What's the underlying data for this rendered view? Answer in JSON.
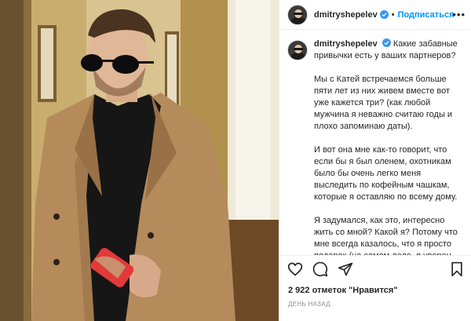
{
  "post": {
    "username": "dmitryshepelev",
    "follow_label": "Подписаться",
    "separator": "•",
    "more_label": "•••",
    "caption": {
      "intro": "Какие забавные привычки есть у ваших партнеров?",
      "paragraphs": [
        "Мы с Катей встречаемся больше пяти лет из них живем вместе вот уже кажется три? (как любой мужчина я неважно считаю годы и плохо запоминаю даты).",
        "И вот она мне как-то говорит, что если бы я был оленем, охотникам было бы очень легко меня выследить по кофейным чашкам, которые я оставляю по всему дому.",
        "Я задумался, как это, интересно жить со мной? Какой я? Потому что мне всегда казалось, что я просто подарок (на самом деле, я уверен, что это не так)."
      ]
    },
    "likes_text": "2 922 отметок \"Нравится\"",
    "time_text": "ДЕНЬ НАЗАД"
  },
  "colors": {
    "accent": "#0095f6",
    "text": "#262626",
    "muted": "#8e8e8e"
  },
  "icons": [
    "heart-icon",
    "comment-icon",
    "share-icon",
    "bookmark-icon",
    "verified-badge-icon"
  ]
}
